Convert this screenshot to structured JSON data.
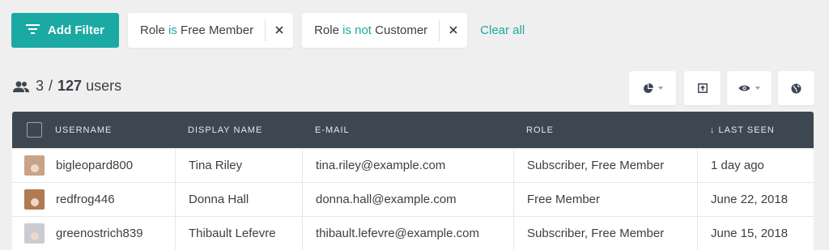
{
  "filters": {
    "add_label": "Add Filter",
    "chips": [
      {
        "field": "Role",
        "operator": "is",
        "value": "Free Member"
      },
      {
        "field": "Role",
        "operator": "is not",
        "value": "Customer"
      }
    ],
    "clear_all": "Clear all"
  },
  "summary": {
    "shown": "3",
    "separator": "/",
    "total": "127",
    "unit": "users"
  },
  "toolbar": {
    "buttons": [
      {
        "icon": "pie-chart-icon",
        "has_caret": true
      },
      {
        "icon": "export-icon",
        "has_caret": false
      },
      {
        "icon": "eye-icon",
        "has_caret": true
      },
      {
        "icon": "globe-icon",
        "has_caret": false
      }
    ]
  },
  "table": {
    "columns": {
      "username": "USERNAME",
      "display_name": "DISPLAY NAME",
      "email": "E-MAIL",
      "role": "ROLE",
      "last_seen": "↓ LAST SEEN"
    },
    "rows": [
      {
        "username": "bigleopard800",
        "display_name": "Tina Riley",
        "email": "tina.riley@example.com",
        "role": "Subscriber, Free Member",
        "last_seen": "1 day ago",
        "avatar_color": "#c8a387"
      },
      {
        "username": "redfrog446",
        "display_name": "Donna Hall",
        "email": "donna.hall@example.com",
        "role": "Free Member",
        "last_seen": "June 22, 2018",
        "avatar_color": "#b07a52"
      },
      {
        "username": "greenostrich839",
        "display_name": "Thibault Lefevre",
        "email": "thibault.lefevre@example.com",
        "role": "Subscriber, Free Member",
        "last_seen": "June 15, 2018",
        "avatar_color": "#c9cdd2"
      }
    ]
  },
  "colors": {
    "accent": "#1ba9a3",
    "header_bg": "#3d4752",
    "page_bg": "#efefef"
  }
}
